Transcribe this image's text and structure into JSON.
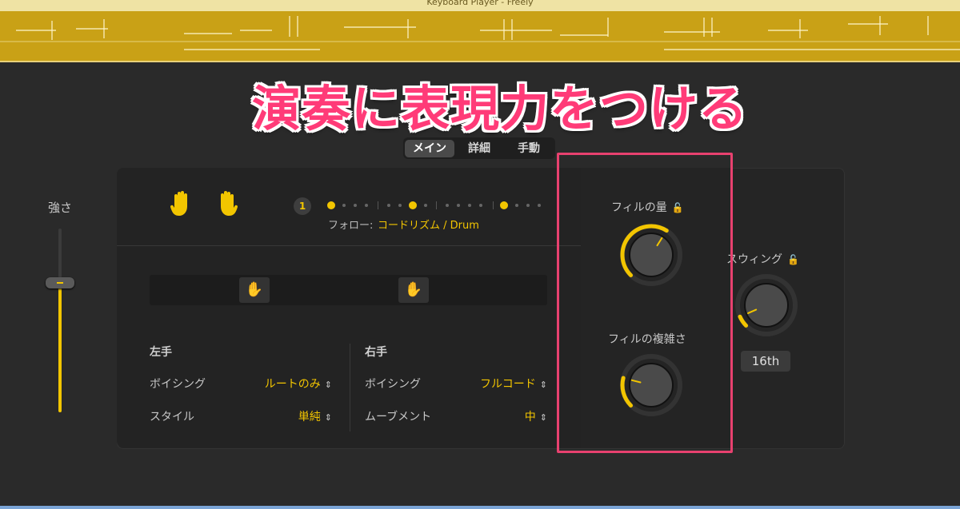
{
  "region": {
    "title": "Keyboard Player - Freely"
  },
  "headline": "演奏に表現力をつける",
  "tabs": [
    {
      "label": "メイン",
      "active": true
    },
    {
      "label": "詳細",
      "active": false
    },
    {
      "label": "手動",
      "active": false
    }
  ],
  "volume": {
    "label": "強さ",
    "level": 0.68
  },
  "pattern": {
    "beat_number": "1",
    "follow_label": "フォロー:",
    "follow_value": "コードリズム / Drum"
  },
  "left_hand": {
    "title": "左手",
    "rows": [
      {
        "label": "ボイシング",
        "value": "ルートのみ"
      },
      {
        "label": "スタイル",
        "value": "単純"
      }
    ]
  },
  "right_hand": {
    "title": "右手",
    "rows": [
      {
        "label": "ボイシング",
        "value": "フルコード"
      },
      {
        "label": "ムーブメント",
        "value": "中"
      }
    ]
  },
  "fill_amount": {
    "label": "フィルの量",
    "level": 0.62
  },
  "fill_complexity": {
    "label": "フィルの複雑さ",
    "level": 0.22
  },
  "swing": {
    "label": "スウィング",
    "level": 0.08,
    "value": "16th"
  },
  "icons": [
    "left-hand-icon",
    "right-hand-icon",
    "lock-icon",
    "chevron-updown-icon"
  ],
  "colors": {
    "accent": "#f2c500",
    "highlight": "#e8416f",
    "headline": "#ff3b78",
    "region": "#c9a116"
  }
}
